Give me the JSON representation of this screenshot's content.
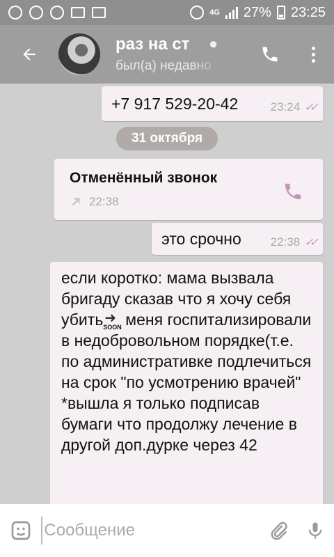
{
  "status_bar": {
    "network": "4G",
    "battery": "27%",
    "time": "23:25"
  },
  "header": {
    "title": "раз на ст",
    "status": "был(а) недавно"
  },
  "messages": [
    {
      "text": "+7 917 529-20-42",
      "time": "23:24",
      "outgoing": true
    },
    {
      "type": "date",
      "text": "31 октября"
    },
    {
      "type": "call",
      "title": "Отменённый звонок",
      "time": "22:38"
    },
    {
      "text": "это срочно",
      "time": "22:38",
      "outgoing": true
    },
    {
      "text": "если коротко: мама вызвала бригаду сказав что я хочу себя убить",
      "emoji": "SOON",
      "text2": "меня госпитализировали в недобровольном порядке(т.е. по административке подлечиться на срок \"по усмотрению врачей\" *вышла я только подписав бумаги что продолжу лечение в другой доп.дурке через 42",
      "incoming": true
    }
  ],
  "input": {
    "placeholder": "Сообщение"
  },
  "colors": {
    "header": "#9e9e9e",
    "bubble": "#f6f0f4",
    "accent": "#c796bd"
  }
}
